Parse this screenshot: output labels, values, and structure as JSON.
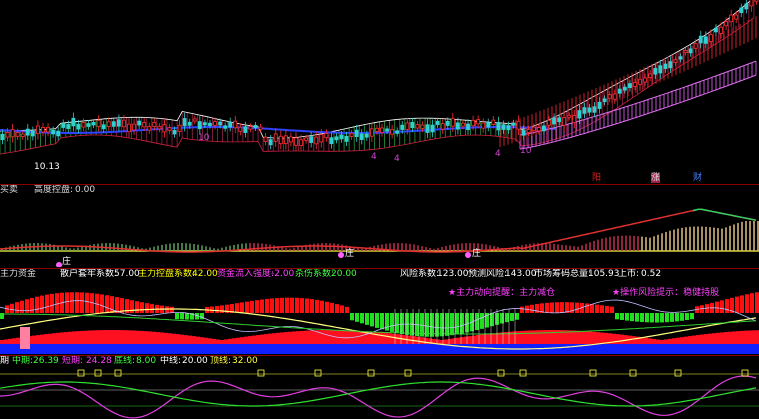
{
  "main_chart": {
    "min_price_label": "10.13",
    "markers": [
      {
        "text": "4",
        "color": "#d040d0"
      },
      {
        "text": "4",
        "color": "#d040d0"
      },
      {
        "text": "4",
        "color": "#d040d0"
      },
      {
        "text": "10",
        "color": "#d040d0"
      },
      {
        "text": "10",
        "color": "#d040d0"
      }
    ],
    "bottom_tags": [
      {
        "text": "阳",
        "color": "#e02020"
      },
      {
        "text": "涨",
        "color": "#e0e0e0"
      },
      {
        "text": "财",
        "color": "#4080ff"
      }
    ]
  },
  "panel1": {
    "name": "买卖",
    "indicator": "高度控盘:",
    "indicator_value": "0.00",
    "zhuang_label_1": "庄",
    "zhuang_label_2": "庄",
    "zhuang_label_3": "庄"
  },
  "panel2": {
    "name": "主力资金",
    "items": [
      {
        "label": "散户套牢系数:",
        "value": "57.00",
        "color": "#ffffff"
      },
      {
        "label": "主力控盘系数:",
        "value": "42.00",
        "color": "#ffff00"
      },
      {
        "label": "资金流入强度:",
        "value": "-2.00",
        "color": "#ff40ff"
      },
      {
        "label": "杀伤系数:",
        "value": "20.00",
        "color": "#40ff40"
      },
      {
        "label": "风险系数:",
        "value": "123.00",
        "color": "#ffffff"
      },
      {
        "label": "预测风险:",
        "value": "143.00",
        "color": "#ffffff"
      },
      {
        "label": "市场筹码总量:",
        "value": "105.93",
        "color": "#ffffff"
      },
      {
        "label": "上市:",
        "value": "0.52",
        "color": "#ffffff"
      }
    ],
    "note1": "★主力动向提醒：主力减仓",
    "note2": "★操作风险提示：稳健持股"
  },
  "panel3": {
    "items": [
      {
        "label": "期",
        "value": "",
        "color": "#ffffff"
      },
      {
        "label": "中期:",
        "value": "26.39",
        "color": "#40ff40"
      },
      {
        "label": "短期:",
        "value": "24.28",
        "color": "#ff40ff"
      },
      {
        "label": "底线:",
        "value": "8.00",
        "color": "#40ff40"
      },
      {
        "label": "中线:",
        "value": "20.00",
        "color": "#ffffff"
      },
      {
        "label": "顶线:",
        "value": "32.00",
        "color": "#ffff40"
      }
    ]
  }
}
